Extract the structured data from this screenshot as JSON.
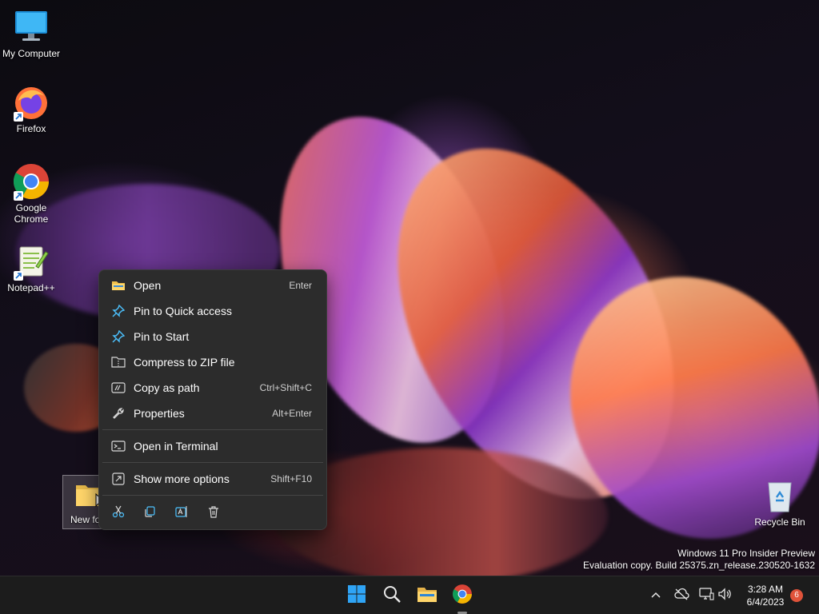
{
  "desktop": {
    "icons": [
      {
        "label": "My Computer"
      },
      {
        "label": "Firefox"
      },
      {
        "label": "Google Chrome"
      },
      {
        "label": "Notepad++"
      },
      {
        "label": "New fo"
      },
      {
        "label": "Recycle Bin"
      }
    ]
  },
  "context_menu": {
    "items": [
      {
        "label": "Open",
        "shortcut": "Enter",
        "icon": "folder-icon"
      },
      {
        "label": "Pin to Quick access",
        "shortcut": "",
        "icon": "pin-icon"
      },
      {
        "label": "Pin to Start",
        "shortcut": "",
        "icon": "pin-icon"
      },
      {
        "label": "Compress to ZIP file",
        "shortcut": "",
        "icon": "zip-icon"
      },
      {
        "label": "Copy as path",
        "shortcut": "Ctrl+Shift+C",
        "icon": "copy-path-icon"
      },
      {
        "label": "Properties",
        "shortcut": "Alt+Enter",
        "icon": "wrench-icon"
      },
      {
        "label": "Open in Terminal",
        "shortcut": "",
        "icon": "terminal-icon"
      },
      {
        "label": "Show more options",
        "shortcut": "Shift+F10",
        "icon": "more-options-icon"
      }
    ],
    "toolbar": [
      "cut-icon",
      "copy-icon",
      "rename-icon",
      "delete-icon"
    ]
  },
  "watermark": {
    "line1": "Windows 11 Pro Insider Preview",
    "line2": "Evaluation copy. Build 25375.zn_release.230520-1632"
  },
  "taskbar": {
    "buttons": [
      "start-icon",
      "search-icon",
      "file-explorer-icon",
      "chrome-icon"
    ],
    "tray": {
      "time": "3:28 AM",
      "date": "6/4/2023",
      "notifications": "6"
    }
  },
  "colors": {
    "menu_bg": "#2c2c2c",
    "taskbar_bg": "#1c1c1c",
    "accent_blue": "#4cc2ff",
    "badge": "#e0533a"
  }
}
